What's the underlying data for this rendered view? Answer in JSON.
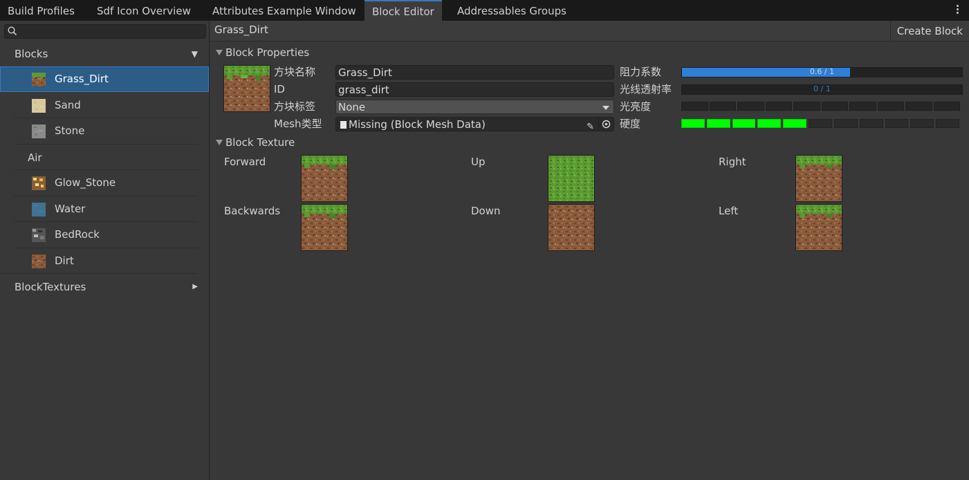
{
  "tabs": [
    {
      "label": "Build Profiles"
    },
    {
      "label": "Sdf Icon Overview"
    },
    {
      "label": "Attributes Example Window"
    },
    {
      "label": "Block Editor"
    },
    {
      "label": "Addressables Groups"
    }
  ],
  "sidebar": {
    "search": {
      "value": "",
      "placeholder": ""
    },
    "groups": {
      "blocks": {
        "label": "Blocks",
        "expanded": true
      },
      "air": {
        "label": "Air"
      },
      "blocktextures": {
        "label": "BlockTextures",
        "expanded": false
      }
    },
    "items": [
      {
        "label": "Grass_Dirt",
        "icon": "grass-dirt-icon",
        "selected": true
      },
      {
        "label": "Sand",
        "icon": "sand-icon"
      },
      {
        "label": "Stone",
        "icon": "stone-icon"
      },
      {
        "label": "Glow_Stone",
        "icon": "glow-stone-icon"
      },
      {
        "label": "Water",
        "icon": "water-icon"
      },
      {
        "label": "BedRock",
        "icon": "bedrock-icon"
      },
      {
        "label": "Dirt",
        "icon": "dirt-icon"
      }
    ]
  },
  "main": {
    "title": "Grass_Dirt",
    "create_button": "Create Block",
    "properties": {
      "header": "Block Properties",
      "name_label": "方块名称",
      "name_value": "Grass_Dirt",
      "id_label": "ID",
      "id_value": "grass_dirt",
      "tag_label": "方块标签",
      "tag_value": "None",
      "mesh_label": "Mesh类型",
      "mesh_value": "Missing (Block Mesh Data)",
      "resistance_label": "阻力系数",
      "resistance_text": "0.6 / 1",
      "resistance_fraction": 0.6,
      "transparency_label": "光线透射率",
      "transparency_text": "0 / 1",
      "transparency_fraction": 0,
      "brightness_label": "光亮度",
      "brightness_level": 0,
      "brightness_max": 10,
      "hardness_label": "硬度",
      "hardness_level": 5,
      "hardness_max": 11
    },
    "texture": {
      "header": "Block Texture",
      "faces": [
        {
          "label": "Forward",
          "texture": "grass-side"
        },
        {
          "label": "Up",
          "texture": "grass-top"
        },
        {
          "label": "Right",
          "texture": "grass-side"
        },
        {
          "label": "Backwards",
          "texture": "grass-side"
        },
        {
          "label": "Down",
          "texture": "dirt"
        },
        {
          "label": "Left",
          "texture": "grass-side"
        }
      ]
    }
  },
  "colors": {
    "accent": "#3a79bb",
    "selection": "#2c5d87",
    "hardness_on": "#00ff00"
  }
}
